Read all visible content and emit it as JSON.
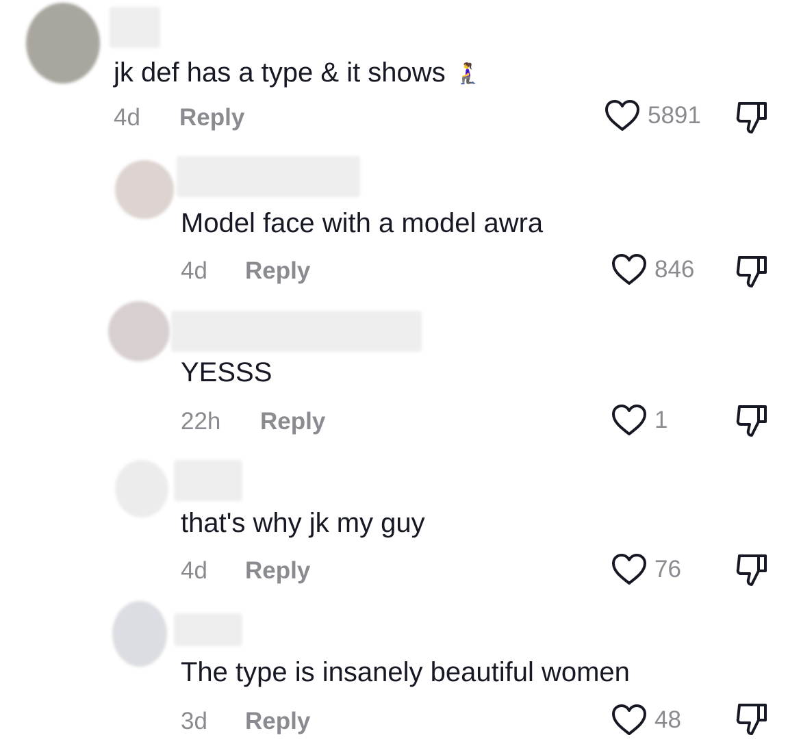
{
  "comments": [
    {
      "text": "jk def has a type & it shows",
      "emoji": "🧎‍♀️",
      "time": "4d",
      "reply_label": "Reply",
      "likes": "5891",
      "avatar_color": "#a8a69e"
    },
    {
      "text": "Model face with a model awra",
      "time": "4d",
      "reply_label": "Reply",
      "likes": "846",
      "avatar_color": "#ddd3d0"
    },
    {
      "text": "YESSS",
      "time": "22h",
      "reply_label": "Reply",
      "likes": "1",
      "avatar_color": "#d8d0d0"
    },
    {
      "text": "that's why jk my guy",
      "time": "4d",
      "reply_label": "Reply",
      "likes": "76",
      "avatar_color": "#ececec"
    },
    {
      "text": "The type is insanely beautiful women",
      "time": "3d",
      "reply_label": "Reply",
      "likes": "48",
      "avatar_color": "#dcdde2"
    }
  ],
  "icons": {
    "like": "heart-outline-icon",
    "dislike": "thumbs-down-icon"
  },
  "colors": {
    "text": "#161823",
    "secondary": "#8a8b91",
    "icon": "#161823"
  }
}
